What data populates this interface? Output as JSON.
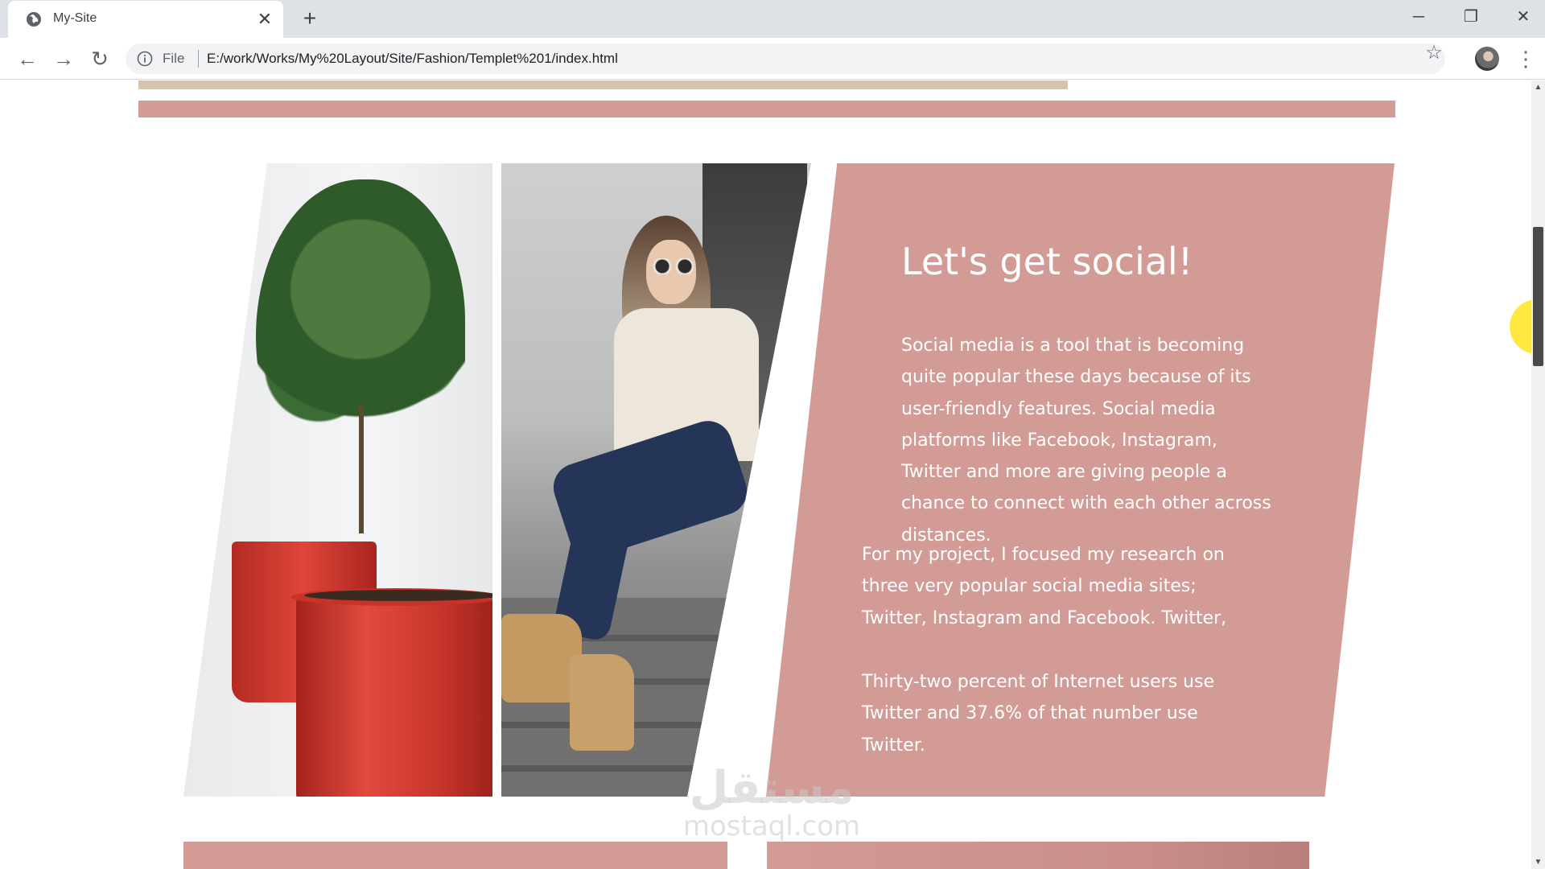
{
  "browser": {
    "tab_title": "My-Site",
    "tab_close": "✕",
    "new_tab": "+",
    "window": {
      "minimize": "─",
      "restore": "❐",
      "close": "✕"
    },
    "nav": {
      "back": "←",
      "forward": "→",
      "reload": "↻"
    },
    "address": {
      "scheme_label": "File",
      "url": "E:/work/Works/My%20Layout/Site/Fashion/Templet%201/index.html"
    },
    "icons": {
      "info": "info-icon",
      "star": "star-icon",
      "menu": "more-vert-icon",
      "favicon": "globe-icon"
    }
  },
  "page": {
    "social": {
      "title": "Let's get social!",
      "paragraph_1": "Social media is a tool that is becoming quite popular these days because of its user-friendly features. Social media platforms like Facebook, Instagram, Twitter and more are giving people a chance to connect with each other across distances.",
      "paragraph_2": "For my project, I focused my research on three very popular social media sites; Twitter, Instagram and Facebook. Twitter,",
      "paragraph_3": "Thirty-two percent of Internet users use Twitter and 37.6% of that number use Twitter."
    },
    "images": {
      "left": "plant-in-red-pot-photo",
      "middle": "woman-sitting-on-stairs-photo"
    },
    "colors": {
      "accent_pink": "#d39b96",
      "accent_beige": "#d6c3b2",
      "text_on_accent": "#ffffff"
    }
  },
  "watermark": {
    "logo": "مستقل",
    "text": "mostaql.com"
  }
}
